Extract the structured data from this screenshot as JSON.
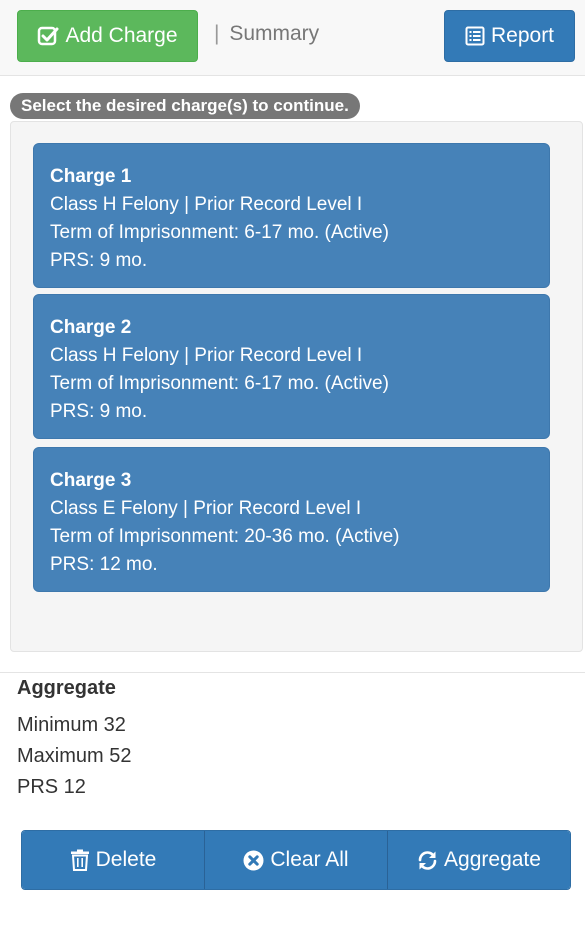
{
  "header": {
    "add_charge_label": "Add Charge",
    "separator": "|",
    "summary_label": "Summary",
    "report_label": "Report"
  },
  "hint": "Select the desired charge(s) to continue.",
  "charges": [
    {
      "title": "Charge 1",
      "class_line": "Class H Felony | Prior Record Level I",
      "term_line": "Term of Imprisonment: 6-17 mo. (Active)",
      "prs_line": "PRS: 9 mo."
    },
    {
      "title": "Charge 2",
      "class_line": "Class H Felony | Prior Record Level I",
      "term_line": "Term of Imprisonment: 6-17 mo. (Active)",
      "prs_line": "PRS: 9 mo."
    },
    {
      "title": "Charge 3",
      "class_line": "Class E Felony | Prior Record Level I",
      "term_line": "Term of Imprisonment: 20-36 mo. (Active)",
      "prs_line": "PRS: 12 mo."
    }
  ],
  "aggregate": {
    "title": "Aggregate",
    "minimum": "Minimum 32",
    "maximum": "Maximum 52",
    "prs": "PRS 12"
  },
  "actions": {
    "delete_label": "Delete",
    "clear_all_label": "Clear All",
    "aggregate_label": "Aggregate"
  },
  "icons": {
    "add": "check-square-icon",
    "report": "list-alt-icon",
    "delete": "trash-icon",
    "clear": "times-circle-icon",
    "aggregate": "refresh-icon"
  },
  "colors": {
    "success": "#5cb85c",
    "primary": "#337ab7",
    "charge_card": "#4682b8",
    "hint_badge": "#777777"
  }
}
